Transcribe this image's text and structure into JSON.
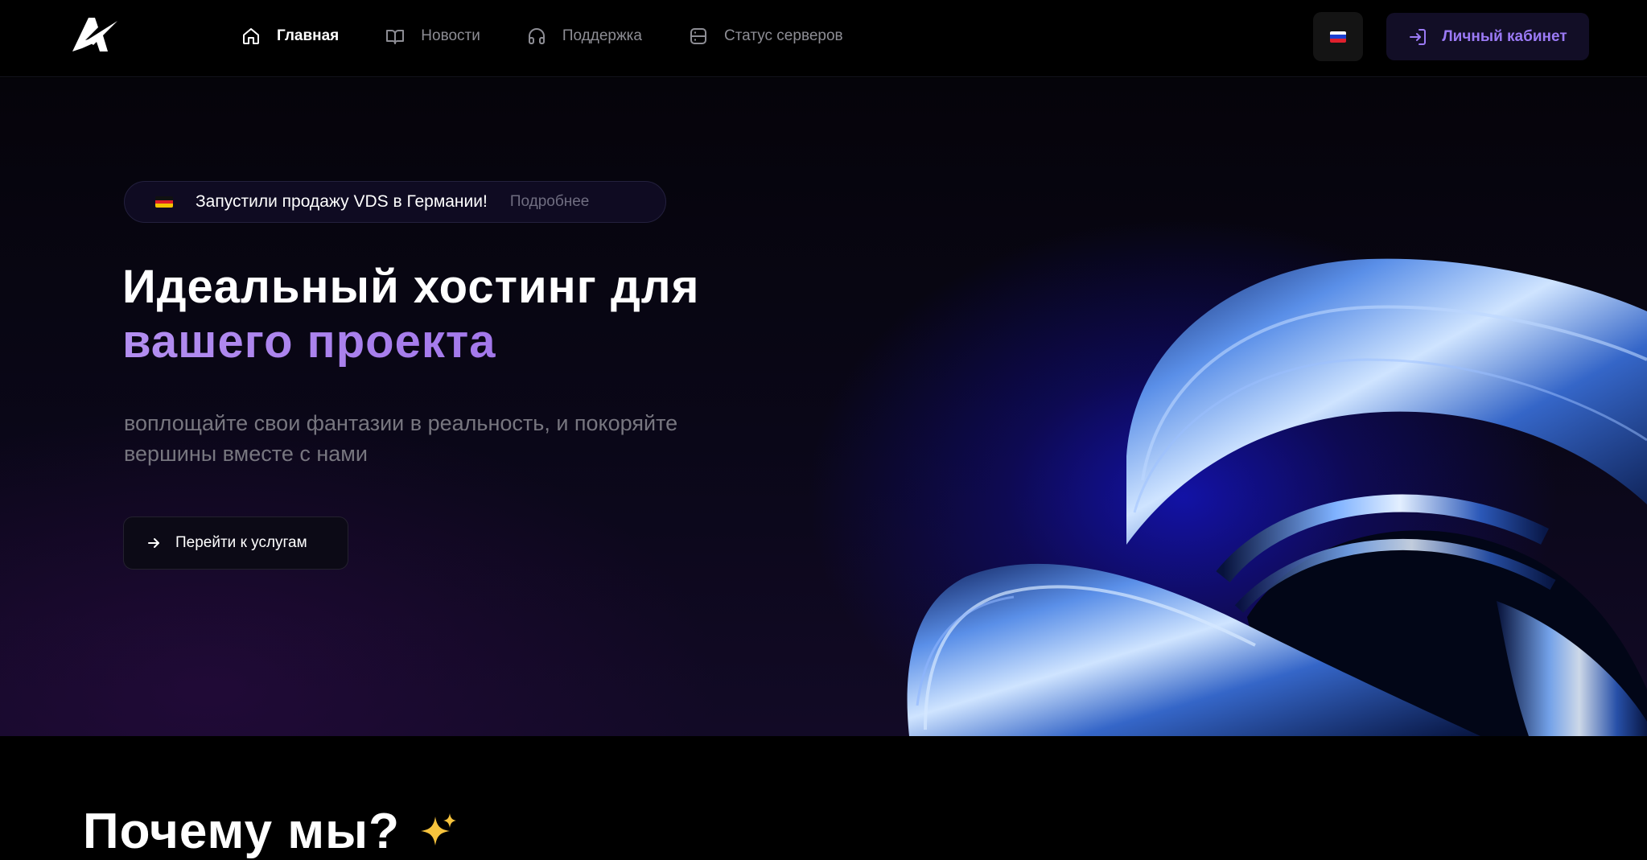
{
  "nav": {
    "items": [
      {
        "label": "Главная",
        "icon": "home-icon",
        "active": true
      },
      {
        "label": "Новости",
        "icon": "book-icon",
        "active": false
      },
      {
        "label": "Поддержка",
        "icon": "headphones-icon",
        "active": false
      },
      {
        "label": "Статус серверов",
        "icon": "server-icon",
        "active": false
      }
    ],
    "language": "ru-flag-icon",
    "cabinet_label": "Личный кабинет"
  },
  "hero": {
    "announcement": {
      "flag": "de-flag-icon",
      "text": "Запустили продажу VDS в Германии!",
      "link": "Подробнее"
    },
    "title_line1": "Идеальный хостинг для",
    "title_line2": "вашего проекта",
    "subtitle_line1": "воплощайте свои фантазии в реальность, и покоряйте",
    "subtitle_line2": "вершины вместе с нами",
    "cta_label": "Перейти к услугам"
  },
  "why": {
    "title": "Почему мы?",
    "icon": "sparkles-icon"
  },
  "colors": {
    "accent": "#9b7af5",
    "accent_gradient_start": "#b38ef0",
    "accent_gradient_end": "#9a6ce8",
    "background": "#000000"
  }
}
